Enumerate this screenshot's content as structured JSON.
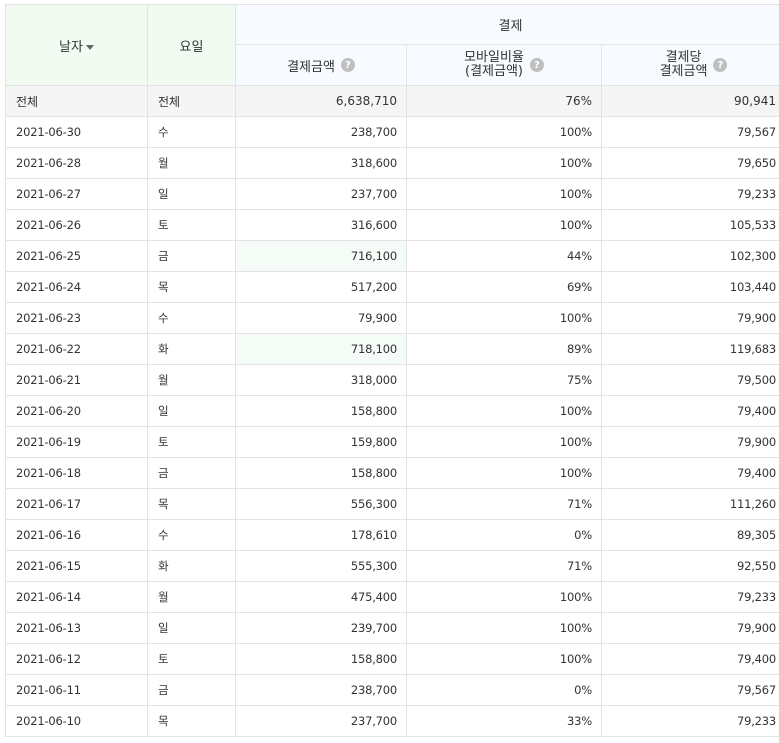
{
  "header": {
    "date_label": "날자",
    "weekday_label": "요일",
    "group_label": "결제",
    "col_amount": "결제금액",
    "col_mobile_line1": "모바일비율",
    "col_mobile_line2": "(결제금액)",
    "col_per_line1": "결제당",
    "col_per_line2": "결제금액",
    "help_glyph": "?"
  },
  "total": {
    "date": "전체",
    "weekday": "전체",
    "amount": "6,638,710",
    "mobile": "76%",
    "per": "90,941"
  },
  "rows": [
    {
      "date": "2021-06-30",
      "weekday": "수",
      "amount": "238,700",
      "mobile": "100%",
      "per": "79,567"
    },
    {
      "date": "2021-06-28",
      "weekday": "월",
      "amount": "318,600",
      "mobile": "100%",
      "per": "79,650"
    },
    {
      "date": "2021-06-27",
      "weekday": "일",
      "amount": "237,700",
      "mobile": "100%",
      "per": "79,233"
    },
    {
      "date": "2021-06-26",
      "weekday": "토",
      "amount": "316,600",
      "mobile": "100%",
      "per": "105,533"
    },
    {
      "date": "2021-06-25",
      "weekday": "금",
      "amount": "716,100",
      "mobile": "44%",
      "per": "102,300"
    },
    {
      "date": "2021-06-24",
      "weekday": "목",
      "amount": "517,200",
      "mobile": "69%",
      "per": "103,440"
    },
    {
      "date": "2021-06-23",
      "weekday": "수",
      "amount": "79,900",
      "mobile": "100%",
      "per": "79,900"
    },
    {
      "date": "2021-06-22",
      "weekday": "화",
      "amount": "718,100",
      "mobile": "89%",
      "per": "119,683"
    },
    {
      "date": "2021-06-21",
      "weekday": "월",
      "amount": "318,000",
      "mobile": "75%",
      "per": "79,500"
    },
    {
      "date": "2021-06-20",
      "weekday": "일",
      "amount": "158,800",
      "mobile": "100%",
      "per": "79,400"
    },
    {
      "date": "2021-06-19",
      "weekday": "토",
      "amount": "159,800",
      "mobile": "100%",
      "per": "79,900"
    },
    {
      "date": "2021-06-18",
      "weekday": "금",
      "amount": "158,800",
      "mobile": "100%",
      "per": "79,400"
    },
    {
      "date": "2021-06-17",
      "weekday": "목",
      "amount": "556,300",
      "mobile": "71%",
      "per": "111,260"
    },
    {
      "date": "2021-06-16",
      "weekday": "수",
      "amount": "178,610",
      "mobile": "0%",
      "per": "89,305"
    },
    {
      "date": "2021-06-15",
      "weekday": "화",
      "amount": "555,300",
      "mobile": "71%",
      "per": "92,550"
    },
    {
      "date": "2021-06-14",
      "weekday": "월",
      "amount": "475,400",
      "mobile": "100%",
      "per": "79,233"
    },
    {
      "date": "2021-06-13",
      "weekday": "일",
      "amount": "239,700",
      "mobile": "100%",
      "per": "79,900"
    },
    {
      "date": "2021-06-12",
      "weekday": "토",
      "amount": "158,800",
      "mobile": "100%",
      "per": "79,400"
    },
    {
      "date": "2021-06-11",
      "weekday": "금",
      "amount": "238,700",
      "mobile": "0%",
      "per": "79,567"
    },
    {
      "date": "2021-06-10",
      "weekday": "목",
      "amount": "237,700",
      "mobile": "33%",
      "per": "79,233"
    }
  ],
  "highlight_color": "#f5fbf6",
  "header_left_bg": "#f1fbf1",
  "header_right_bg": "#f7faff"
}
